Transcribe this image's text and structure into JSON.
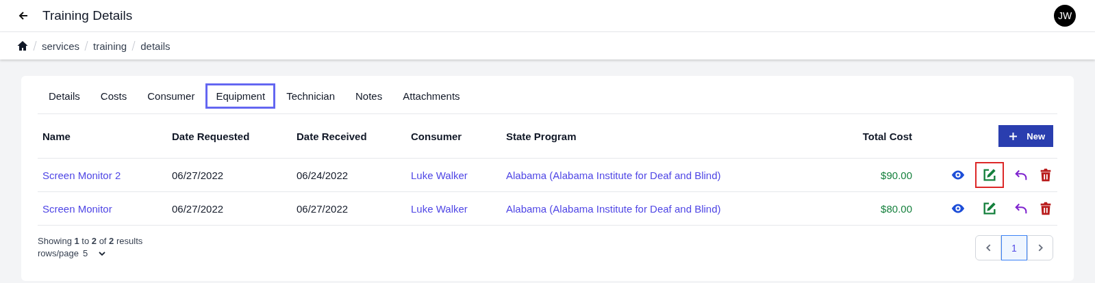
{
  "header": {
    "title": "Training Details",
    "avatar": "JW"
  },
  "breadcrumb": [
    "services",
    "training",
    "details"
  ],
  "tabs": [
    {
      "label": "Details",
      "selected": false
    },
    {
      "label": "Costs",
      "selected": false
    },
    {
      "label": "Consumer",
      "selected": false
    },
    {
      "label": "Equipment",
      "selected": true
    },
    {
      "label": "Technician",
      "selected": false
    },
    {
      "label": "Notes",
      "selected": false
    },
    {
      "label": "Attachments",
      "selected": false
    }
  ],
  "table": {
    "columns": [
      "Name",
      "Date Requested",
      "Date Received",
      "Consumer",
      "State Program",
      "Total Cost"
    ],
    "new_button": "New",
    "rows": [
      {
        "name": "Screen Monitor 2",
        "date_requested": "06/27/2022",
        "date_received": "06/24/2022",
        "consumer": "Luke Walker",
        "state_program": "Alabama (Alabama Institute for Deaf and Blind)",
        "total_cost": "$90.00",
        "edit_focused": true
      },
      {
        "name": "Screen Monitor",
        "date_requested": "06/27/2022",
        "date_received": "06/27/2022",
        "consumer": "Luke Walker",
        "state_program": "Alabama (Alabama Institute for Deaf and Blind)",
        "total_cost": "$80.00",
        "edit_focused": false
      }
    ]
  },
  "footer": {
    "summary": "Showing **1** to **2** of **2** results",
    "rows_label": "rows/page",
    "rows_value": "5"
  },
  "pagination": {
    "pages": [
      {
        "label": "1",
        "selected": true
      }
    ]
  }
}
